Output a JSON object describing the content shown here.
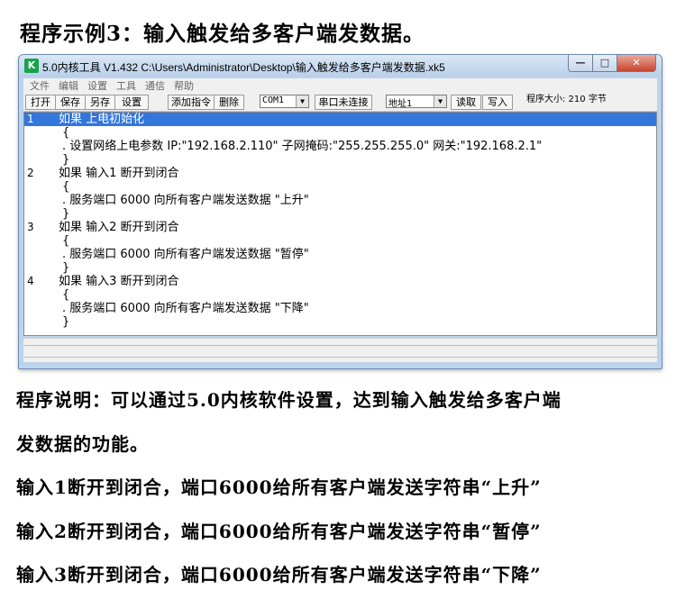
{
  "heading": "程序示例3：输入触发给多客户端发数据。",
  "window": {
    "title": "5.0内核工具 V1.432 C:\\Users\\Administrator\\Desktop\\输入触发给多客户端发数据.xk5",
    "icon_letter": "K",
    "minimize_icon": "minimize-icon",
    "maximize_icon": "maximize-icon",
    "close_icon": "close-icon"
  },
  "menu": [
    "文件",
    "编辑",
    "设置",
    "工具",
    "通信",
    "帮助"
  ],
  "toolbar": {
    "open": "打开",
    "save": "保存",
    "save_as": "另存",
    "settings": "设置",
    "add_cmd": "添加指令",
    "delete": "删除",
    "com_port": "COM1",
    "port_status": "串口未连接",
    "address": "地址1",
    "read": "读取",
    "write": "写入",
    "program_size": "程序大小: 210 字节"
  },
  "code_lines": [
    {
      "num": "1",
      "text": "如果  上电初始化",
      "selected": true
    },
    {
      "num": "",
      "text": "{"
    },
    {
      "num": "",
      "text": ".   设置网络上电参数 IP:\"192.168.2.110\" 子网掩码:\"255.255.255.0\" 网关:\"192.168.2.1\""
    },
    {
      "num": "",
      "text": "}"
    },
    {
      "num": "2",
      "text": "如果  输入1 断开到闭合"
    },
    {
      "num": "",
      "text": "{"
    },
    {
      "num": "",
      "text": ".   服务端口 6000 向所有客户端发送数据 \"上升\""
    },
    {
      "num": "",
      "text": "}"
    },
    {
      "num": "3",
      "text": "如果  输入2 断开到闭合"
    },
    {
      "num": "",
      "text": "{"
    },
    {
      "num": "",
      "text": ".   服务端口 6000 向所有客户端发送数据 \"暂停\""
    },
    {
      "num": "",
      "text": "}"
    },
    {
      "num": "4",
      "text": "如果  输入3 断开到闭合"
    },
    {
      "num": "",
      "text": "{"
    },
    {
      "num": "",
      "text": ".   服务端口 6000 向所有客户端发送数据 \"下降\""
    },
    {
      "num": "",
      "text": "}"
    }
  ],
  "description": {
    "line1": "程序说明：可以通过5.0内核软件设置，达到输入触发给多客户端",
    "line2": "发数据的功能。",
    "line3": "输入1断开到闭合，端口6000给所有客户端发送字符串“上升”",
    "line4": "输入2断开到闭合，端口6000给所有客户端发送字符串“暂停”",
    "line5": "输入3断开到闭合，端口6000给所有客户端发送字符串“下降”"
  },
  "colors": {
    "selection": "#3376dc",
    "window_frame": "#bcd3ec"
  }
}
